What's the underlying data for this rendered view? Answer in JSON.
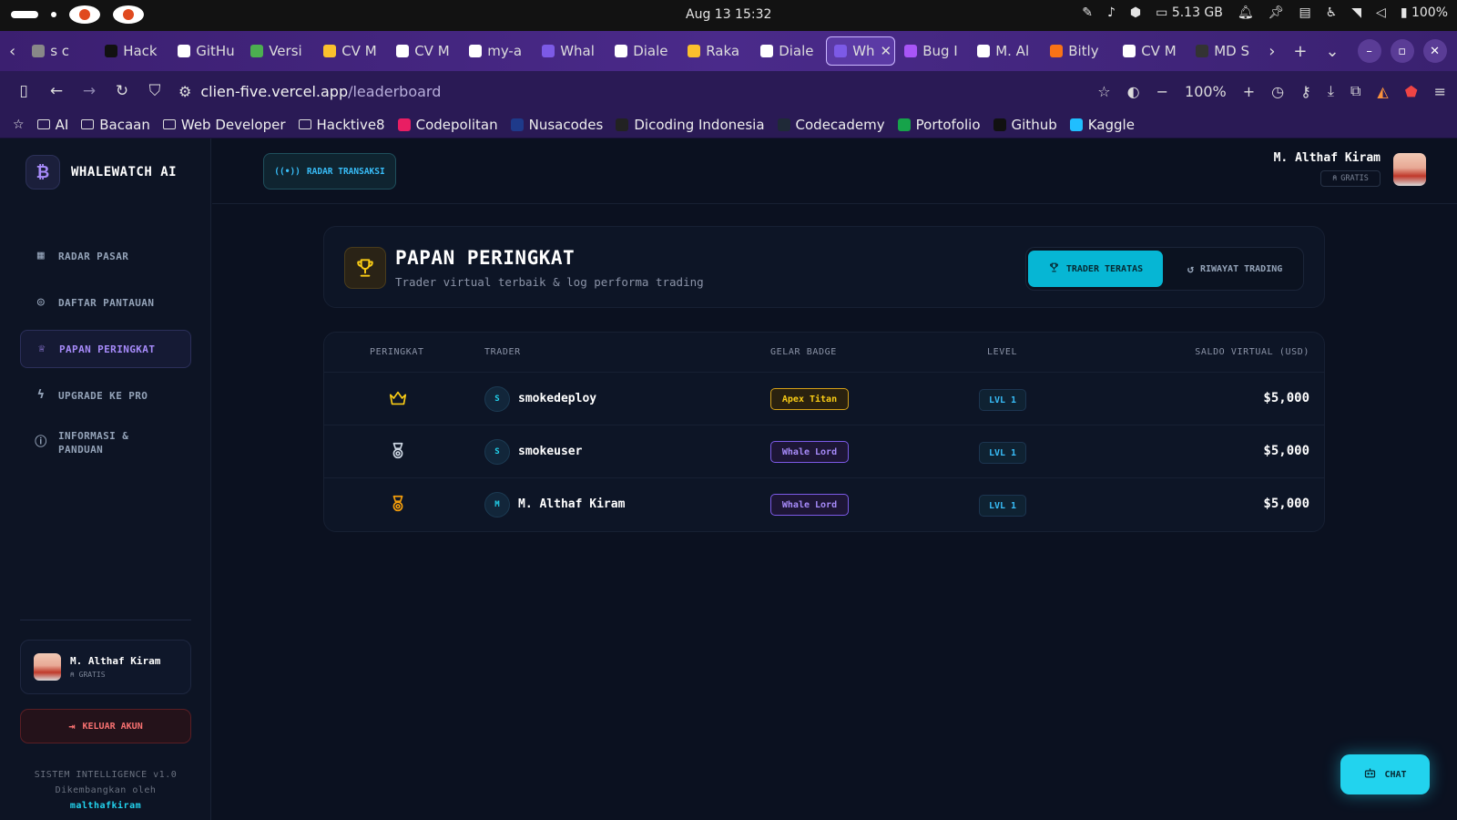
{
  "os": {
    "clock": "Aug 13  15:32",
    "memory": "5.13 GB",
    "battery": "100%"
  },
  "browser": {
    "tabs": [
      {
        "label": "s c",
        "color": "#888"
      },
      {
        "label": "Hack",
        "color": "#111"
      },
      {
        "label": "GitHu",
        "color": "#fff"
      },
      {
        "label": "Versi",
        "color": "#4caf50"
      },
      {
        "label": "CV M",
        "color": "#fbc02d"
      },
      {
        "label": "CV M",
        "color": "#fff"
      },
      {
        "label": "my-a",
        "color": "#fff"
      },
      {
        "label": "Whal",
        "color": "#7c5ae6"
      },
      {
        "label": "Diale",
        "color": "#fff"
      },
      {
        "label": "Raka",
        "color": "#fbc02d"
      },
      {
        "label": "Diale",
        "color": "#fff"
      },
      {
        "label": "Wh",
        "color": "#7c5ae6",
        "active": true
      },
      {
        "label": "Bug I",
        "color": "#a855f7"
      },
      {
        "label": "M. Al",
        "color": "#fff"
      },
      {
        "label": "Bitly",
        "color": "#f97316"
      },
      {
        "label": "CV M",
        "color": "#fff"
      },
      {
        "label": "MD S",
        "color": "#333"
      }
    ],
    "url_host": "clien-five.vercel.app",
    "url_path": "/leaderboard",
    "zoom": "100%",
    "bookmarks": [
      {
        "label": "AI",
        "type": "folder"
      },
      {
        "label": "Bacaan",
        "type": "folder"
      },
      {
        "label": "Web Developer",
        "type": "folder"
      },
      {
        "label": "Hacktive8",
        "type": "folder"
      },
      {
        "label": "Codepolitan",
        "type": "site",
        "color": "#e91e63"
      },
      {
        "label": "Nusacodes",
        "type": "site",
        "color": "#1e3a8a"
      },
      {
        "label": "Dicoding Indonesia",
        "type": "site",
        "color": "#222"
      },
      {
        "label": "Codecademy",
        "type": "site",
        "color": "#1f2937"
      },
      {
        "label": "Portofolio",
        "type": "site",
        "color": "#16a34a"
      },
      {
        "label": "Github",
        "type": "site",
        "color": "#111"
      },
      {
        "label": "Kaggle",
        "type": "site",
        "color": "#20beff"
      }
    ]
  },
  "sidebar": {
    "brand": "WHALEWATCH AI",
    "items": [
      {
        "label": "RADAR PASAR",
        "icon": "grid-icon"
      },
      {
        "label": "DAFTAR PANTAUAN",
        "icon": "watch-icon"
      },
      {
        "label": "PAPAN PERINGKAT",
        "icon": "trophy-icon",
        "active": true
      },
      {
        "label": "UPGRADE KE PRO",
        "icon": "bolt-icon"
      },
      {
        "label": "INFORMASI & PANDUAN",
        "icon": "info-icon"
      }
    ],
    "user_name": "M. Althaf Kiram",
    "user_tier": "GRATIS",
    "logout": "KELUAR AKUN",
    "footer_line1": "SISTEM INTELLIGENCE v1.0",
    "footer_line2": "Dikembangkan oleh",
    "footer_dev": "malthafkiram"
  },
  "topbar": {
    "radar_button": "RADAR TRANSAKSI",
    "user_name": "M. Althaf Kiram",
    "user_tier": "GRATIS"
  },
  "leaderboard": {
    "title": "PAPAN PERINGKAT",
    "subtitle": "Trader virtual terbaik & log performa trading",
    "tab_top": "TRADER TERATAS",
    "tab_history": "RIWAYAT TRADING",
    "columns": [
      "PERINGKAT",
      "TRADER",
      "GELAR BADGE",
      "LEVEL",
      "SALDO VIRTUAL (USD)"
    ],
    "rows": [
      {
        "rank_icon": "crown-icon",
        "initial": "S",
        "name": "smokedeploy",
        "badge": "Apex Titan",
        "badge_style": "gold",
        "level": "LVL 1",
        "balance": "$5,000"
      },
      {
        "rank_icon": "silver-medal-icon",
        "initial": "S",
        "name": "smokeuser",
        "badge": "Whale Lord",
        "badge_style": "purple",
        "level": "LVL 1",
        "balance": "$5,000"
      },
      {
        "rank_icon": "bronze-medal-icon",
        "initial": "M",
        "name": "M. Althaf Kiram",
        "badge": "Whale Lord",
        "badge_style": "purple",
        "level": "LVL 1",
        "balance": "$5,000"
      }
    ]
  },
  "chat_button": "CHAT",
  "colors": {
    "accent": "#06b6d4",
    "purple": "#a78bfa",
    "gold": "#facc15",
    "danger": "#f87171"
  }
}
